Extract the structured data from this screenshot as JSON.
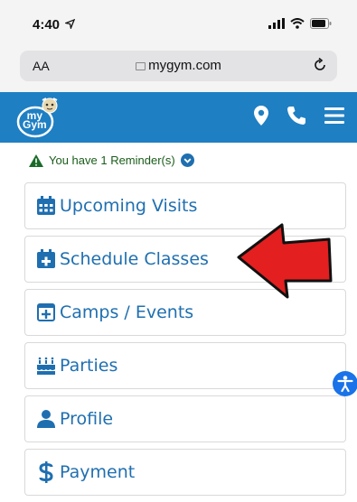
{
  "status_bar": {
    "time": "4:40"
  },
  "browser": {
    "aa_label": "AA",
    "url": "mygym.com"
  },
  "header": {
    "logo_text_top": "my",
    "logo_text_bottom": "Gym"
  },
  "reminder": {
    "text": "You have 1 Reminder(s)"
  },
  "menu": {
    "items": [
      {
        "label": "Upcoming Visits",
        "icon": "calendar-grid-icon"
      },
      {
        "label": "Schedule Classes",
        "icon": "calendar-plus-icon"
      },
      {
        "label": "Camps / Events",
        "icon": "plus-square-icon"
      },
      {
        "label": "Parties",
        "icon": "birthday-cake-icon"
      },
      {
        "label": "Profile",
        "icon": "user-icon"
      },
      {
        "label": "Payment",
        "icon": "dollar-icon"
      }
    ]
  },
  "colors": {
    "header": "#1f7fc3",
    "link": "#1f6fb0",
    "reminder": "#1a5c1a",
    "arrow": "#e41f1f",
    "accessibility": "#1a73e8"
  }
}
